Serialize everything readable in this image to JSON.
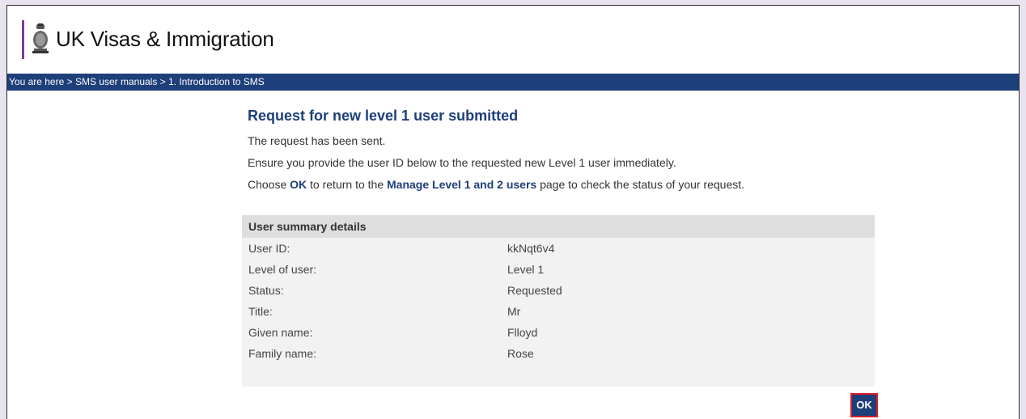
{
  "header": {
    "title": "UK Visas & Immigration"
  },
  "breadcrumb": {
    "text": "You are here > SMS user manuals > 1. Introduction to SMS"
  },
  "page": {
    "heading": "Request for new level 1 user submitted",
    "line1": "The request has been sent.",
    "line2": "Ensure you provide the user ID below to the requested new Level 1 user immediately.",
    "line3_pre": "Choose ",
    "line3_ok": "OK",
    "line3_mid": " to return to the ",
    "line3_link": "Manage Level 1 and 2 users",
    "line3_post": " page to check the status of your request."
  },
  "summary": {
    "title": "User summary details",
    "rows": [
      {
        "label": "User ID:",
        "value": "kkNqt6v4"
      },
      {
        "label": "Level of user:",
        "value": "Level 1"
      },
      {
        "label": "Status:",
        "value": "Requested"
      },
      {
        "label": "Title:",
        "value": "Mr"
      },
      {
        "label": "Given name:",
        "value": "Flloyd"
      },
      {
        "label": "Family name:",
        "value": "Rose"
      }
    ]
  },
  "ok_button": {
    "label": "OK"
  },
  "colors": {
    "brand": "#1d3f7a",
    "accent": "#7c3f98",
    "highlight": "#d81e2a"
  }
}
